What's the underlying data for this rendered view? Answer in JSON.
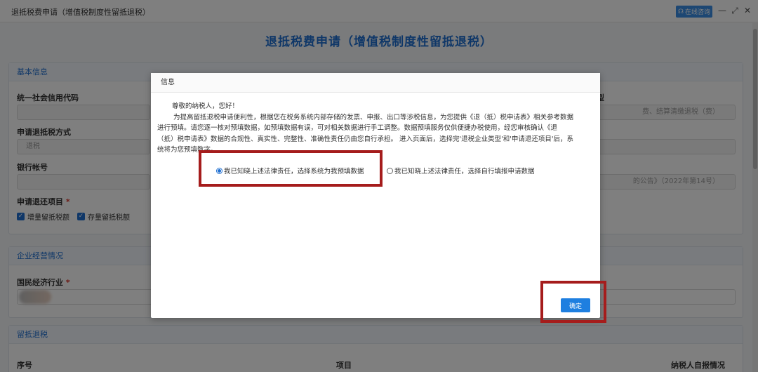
{
  "window": {
    "title": "退抵税费申请（增值税制度性留抵退税）",
    "consult_label": "在线咨询",
    "minimize": "—",
    "maximize": "⤢",
    "close": "✕"
  },
  "page": {
    "title": "退抵税费申请（增值税制度性留抵退税）",
    "basic_info": {
      "header": "基本信息",
      "credit_code_label": "统一社会信用代码",
      "refund_method_label": "申请退抵税方式",
      "refund_method_value": "退税",
      "bank_account_label": "银行帐号",
      "refund_items_label": "申请退还项目",
      "required_mark": "*",
      "right_type_label_fragment": "型",
      "right_type_value_fragment": "费、结算清缴退税（费）",
      "right_notice_fragment": "的公告》（2022年第14号）",
      "check_items": [
        {
          "label": "增量留抵税额",
          "checked": true
        },
        {
          "label": "存量留抵税额",
          "checked": true
        }
      ]
    },
    "business": {
      "header": "企业经营情况",
      "industry_label": "国民经济行业"
    },
    "retention": {
      "header": "留抵退税",
      "columns": [
        "序号",
        "项目",
        "纳税人自报情况"
      ]
    }
  },
  "dialog": {
    "title": "信息",
    "greeting": "尊敬的纳税人，您好！",
    "body_lines": [
      "为提高留抵退税申请便利性，根据您在税务系统内部存储的发票、申报、出口等涉税信息，为您提供《退（抵）税申请表》相关参考数据",
      "进行预填。请您逐一核对预填数据，如预填数据有误，可对相关数据进行手工调整。数据预填服务仅供便捷办税使用，经您审核确认《退",
      "（抵）税申请表》数据的合规性、真实性、完整性、准确性责任仍由您自行承担。 进入页面后，选择完'退税企业类型'和'申请退还项目'后，系",
      "统将为您预填数字。"
    ],
    "options": [
      {
        "label": "我已知晓上述法律责任，选择系统为我预填数据",
        "selected": true
      },
      {
        "label": "我已知晓上述法律责任，选择自行填报申请数据",
        "selected": false
      }
    ],
    "ok_label": "确定"
  },
  "colors": {
    "accent": "#1f6fd1",
    "highlight": "#a51c1c",
    "mask": "rgba(0,0,0,0.5)"
  }
}
